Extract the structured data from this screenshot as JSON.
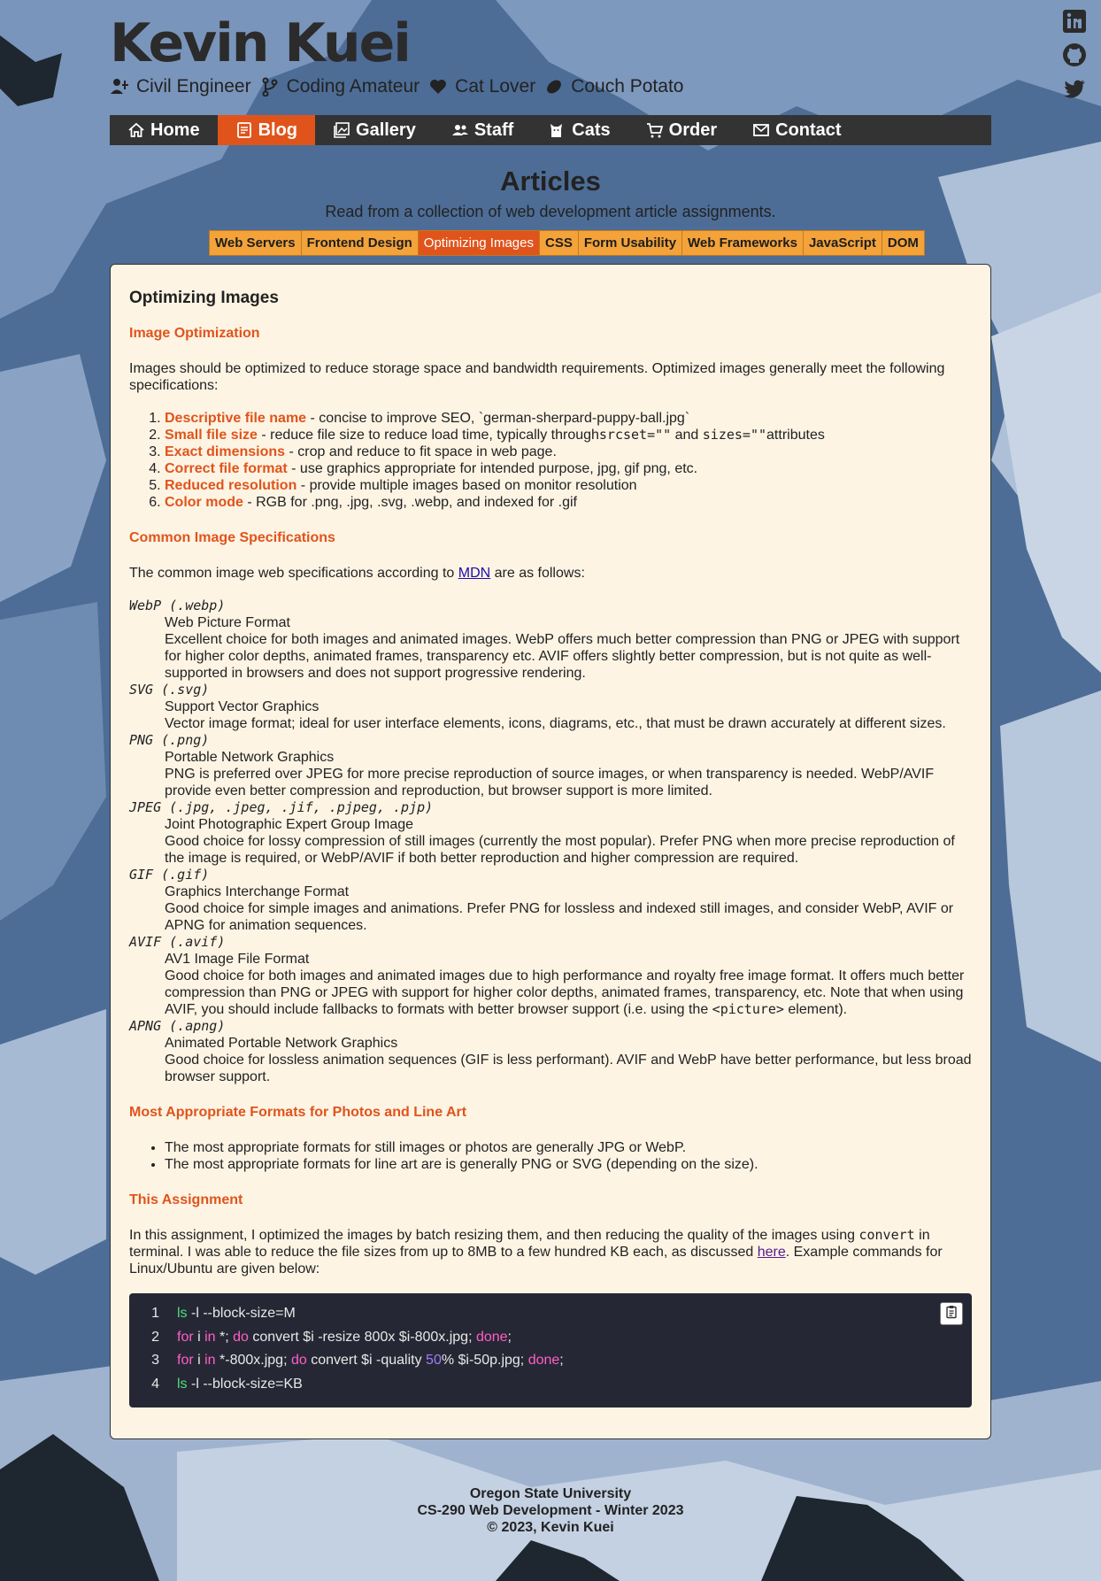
{
  "site": {
    "title": "Kevin Kuei",
    "tags": [
      {
        "label": "Civil Engineer",
        "icon": "engineer-icon"
      },
      {
        "label": "Coding Amateur",
        "icon": "branch-icon"
      },
      {
        "label": "Cat Lover",
        "icon": "heart-icon"
      },
      {
        "label": "Couch Potato",
        "icon": "potato-icon"
      }
    ],
    "social": [
      "linkedin-icon",
      "github-icon",
      "twitter-icon"
    ]
  },
  "nav": {
    "items": [
      {
        "label": "Home",
        "icon": "home-icon",
        "active": false
      },
      {
        "label": "Blog",
        "icon": "blog-icon",
        "active": true
      },
      {
        "label": "Gallery",
        "icon": "gallery-icon",
        "active": false
      },
      {
        "label": "Staff",
        "icon": "staff-icon",
        "active": false
      },
      {
        "label": "Cats",
        "icon": "cat-icon",
        "active": false
      },
      {
        "label": "Order",
        "icon": "cart-icon",
        "active": false
      },
      {
        "label": "Contact",
        "icon": "mail-icon",
        "active": false
      }
    ]
  },
  "page": {
    "title": "Articles",
    "subtitle": "Read from a collection of web development article assignments."
  },
  "subnav": {
    "items": [
      "Web Servers",
      "Frontend Design",
      "Optimizing Images",
      "CSS",
      "Form Usability",
      "Web Frameworks",
      "JavaScript",
      "DOM"
    ],
    "active": "Optimizing Images"
  },
  "article": {
    "title": "Optimizing Images",
    "s1": {
      "heading": "Image Optimization",
      "intro": "Images should be optimized to reduce storage space and bandwidth requirements. Optimized images generally meet the following specifications:",
      "items": [
        {
          "term": "Descriptive file name",
          "text": " - concise to improve SEO, `german-sherpard-puppy-ball.jpg`"
        },
        {
          "term": "Small file size",
          "text": " - reduce file size to reduce load time, typically through",
          "code1": "srcset=\"\"",
          "mid": " and ",
          "code2": "sizes=\"\"",
          "end": "attributes"
        },
        {
          "term": "Exact dimensions",
          "text": " - crop and reduce to fit space in web page."
        },
        {
          "term": "Correct file format",
          "text": " - use graphics appropriate for intended purpose, jpg, gif png, etc."
        },
        {
          "term": "Reduced resolution",
          "text": " - provide multiple images based on monitor resolution"
        },
        {
          "term": "Color mode",
          "text": " - RGB for .png, .jpg, .svg, .webp, and indexed for .gif"
        }
      ]
    },
    "s2": {
      "heading": "Common Image Specifications",
      "intro_pre": "The common image web specifications according to ",
      "intro_link": "MDN",
      "intro_post": " are as follows:",
      "formats": [
        {
          "term": "WebP (.webp)",
          "name": "Web Picture Format",
          "desc": "Excellent choice for both images and animated images. WebP offers much better compression than PNG or JPEG with support for higher color depths, animated frames, transparency etc. AVIF offers slightly better compression, but is not quite as well-supported in browsers and does not support progressive rendering."
        },
        {
          "term": "SVG (.svg)",
          "name": "Support Vector Graphics",
          "desc": "Vector image format; ideal for user interface elements, icons, diagrams, etc., that must be drawn accurately at different sizes."
        },
        {
          "term": "PNG (.png)",
          "name": "Portable Network Graphics",
          "desc": "PNG is preferred over JPEG for more precise reproduction of source images, or when transparency is needed. WebP/AVIF provide even better compression and reproduction, but browser support is more limited."
        },
        {
          "term": "JPEG (.jpg, .jpeg, .jif, .pjpeg, .pjp)",
          "name": "Joint Photographic Expert Group Image",
          "desc": "Good choice for lossy compression of still images (currently the most popular). Prefer PNG when more precise reproduction of the image is required, or WebP/AVIF if both better reproduction and higher compression are required."
        },
        {
          "term": "GIF (.gif)",
          "name": "Graphics Interchange Format",
          "desc": "Good choice for simple images and animations. Prefer PNG for lossless and indexed still images, and consider WebP, AVIF or APNG for animation sequences."
        },
        {
          "term": "AVIF (.avif)",
          "name": "AV1 Image File Format",
          "desc": "Good choice for both images and animated images due to high performance and royalty free image format. It offers much better compression than PNG or JPEG with support for higher color depths, animated frames, transparency, etc. Note that when using AVIF, you should include fallbacks to formats with better browser support (i.e. using the ",
          "desc_code": "<picture>",
          "desc_end": " element)."
        },
        {
          "term": "APNG (.apng)",
          "name": "Animated Portable Network Graphics",
          "desc": "Good choice for lossless animation sequences (GIF is less performant). AVIF and WebP have better performance, but less broad browser support."
        }
      ]
    },
    "s3": {
      "heading": "Most Appropriate Formats for Photos and Line Art",
      "items": [
        "The most appropriate formats for still images or photos are generally JPG or WebP.",
        "The most appropriate formats for line art are is generally PNG or SVG (depending on the size)."
      ]
    },
    "s4": {
      "heading": "This Assignment",
      "p_pre": "In this assignment, I optimized the images by batch resizing them, and then reducing the quality of the images using ",
      "p_code": "convert",
      "p_mid": " in terminal. I was able to reduce the file sizes from up to 8MB to a few hundred KB each, as discussed ",
      "p_link": "here",
      "p_post": ". Example commands for Linux/Ubuntu are given below:"
    },
    "code": {
      "lines": [
        {
          "n": "1",
          "parts": [
            {
              "t": "ls",
              "c": "fn"
            },
            {
              "t": " -l --block-size=M",
              "c": ""
            }
          ]
        },
        {
          "n": "2",
          "parts": [
            {
              "t": "for",
              "c": "kw"
            },
            {
              "t": " i ",
              "c": ""
            },
            {
              "t": "in",
              "c": "kw"
            },
            {
              "t": " *; ",
              "c": ""
            },
            {
              "t": "do",
              "c": "kw"
            },
            {
              "t": " convert $i -resize 800x $i-800x.jpg; ",
              "c": ""
            },
            {
              "t": "done",
              "c": "kw"
            },
            {
              "t": ";",
              "c": ""
            }
          ]
        },
        {
          "n": "3",
          "parts": [
            {
              "t": "for",
              "c": "kw"
            },
            {
              "t": " i ",
              "c": ""
            },
            {
              "t": "in",
              "c": "kw"
            },
            {
              "t": " *-800x.jpg; ",
              "c": ""
            },
            {
              "t": "do",
              "c": "kw"
            },
            {
              "t": " convert $i -quality ",
              "c": ""
            },
            {
              "t": "50",
              "c": "num"
            },
            {
              "t": "% $i-50p.jpg; ",
              "c": ""
            },
            {
              "t": "done",
              "c": "kw"
            },
            {
              "t": ";",
              "c": ""
            }
          ]
        },
        {
          "n": "4",
          "parts": [
            {
              "t": "ls",
              "c": "fn"
            },
            {
              "t": " -l --block-size=KB",
              "c": ""
            }
          ]
        }
      ]
    }
  },
  "footer": {
    "lines": [
      "Oregon State University",
      "CS-290 Web Development - Winter 2023",
      "© 2023, Kevin Kuei"
    ]
  },
  "colors": {
    "accent": "#e0541c",
    "nav_bg": "#333333",
    "subnav_bg": "#f3a33a",
    "card_bg": "#fdf4e4",
    "code_bg": "#262734"
  }
}
